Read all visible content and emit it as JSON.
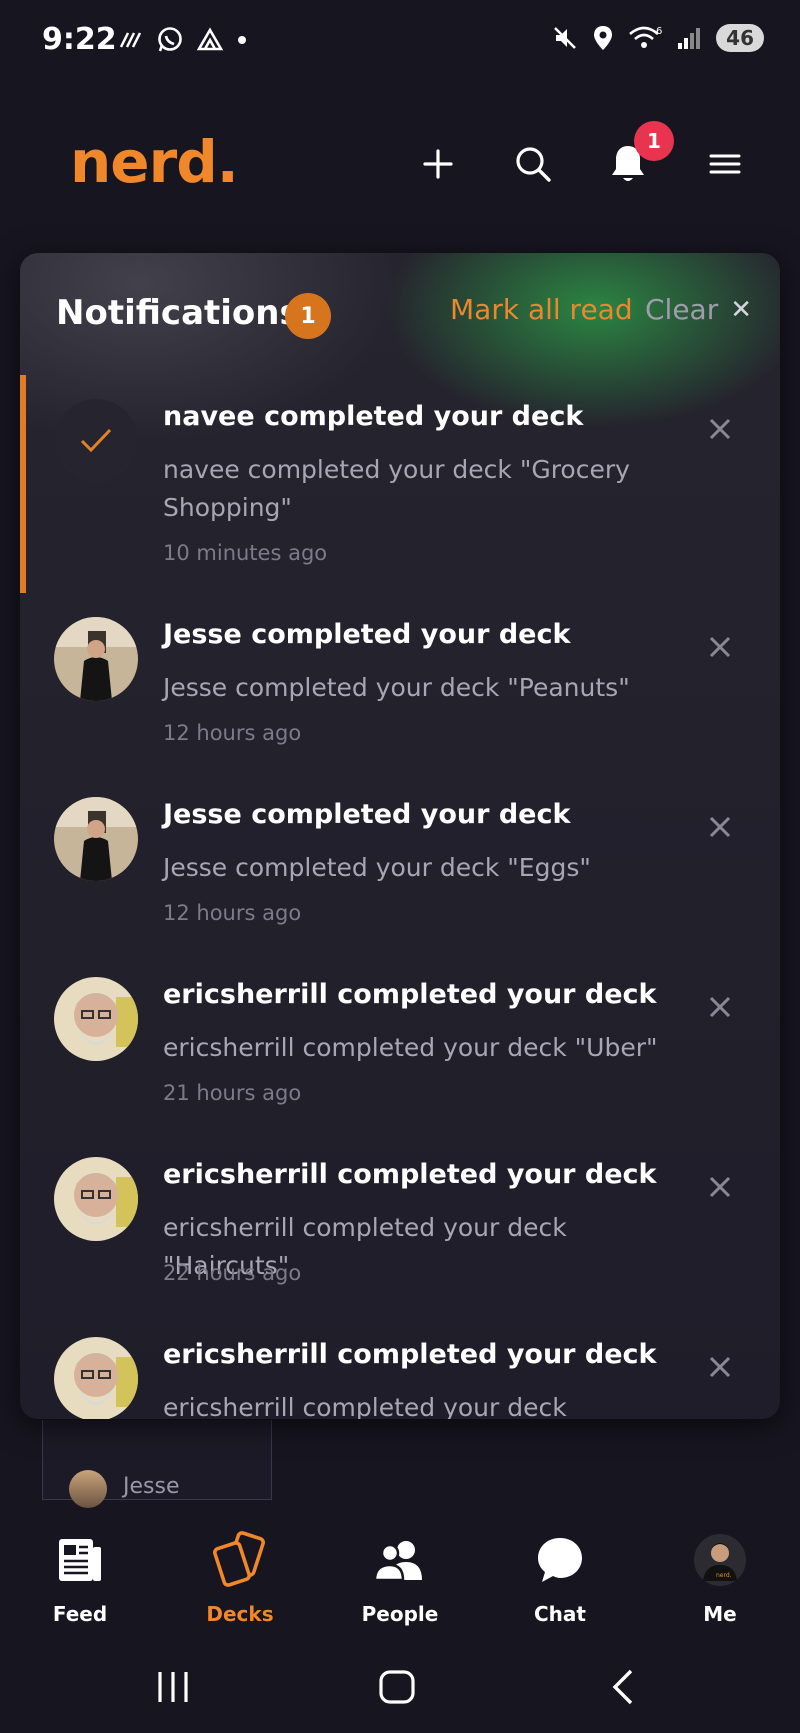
{
  "status_bar": {
    "time": "9:22",
    "battery": "46"
  },
  "header": {
    "logo": "nerd.",
    "notification_badge": "1"
  },
  "notifications": {
    "title": "Notifications",
    "count": "1",
    "mark_all_read": "Mark all read",
    "clear": "Clear",
    "items": [
      {
        "title": "navee completed your deck",
        "body": "navee completed your deck \"Grocery Shopping\"",
        "time": "10 minutes ago",
        "unread": true
      },
      {
        "title": "Jesse completed your deck",
        "body": "Jesse completed your deck \"Peanuts\"",
        "time": "12 hours ago"
      },
      {
        "title": "Jesse completed your deck",
        "body": "Jesse completed your deck \"Eggs\"",
        "time": "12 hours ago"
      },
      {
        "title": "ericsherrill completed your deck",
        "body": "ericsherrill completed your deck \"Uber\"",
        "time": "21 hours ago"
      },
      {
        "title": "ericsherrill completed your deck",
        "body": "ericsherrill completed your deck \"Haircuts\"",
        "time": "22 hours ago"
      },
      {
        "title": "ericsherrill completed your deck",
        "body": "ericsherrill completed your deck \"Christmas"
      }
    ]
  },
  "background_card": {
    "user": "Jesse"
  },
  "bottom_nav": {
    "items": [
      {
        "label": "Feed",
        "icon": "feed-icon"
      },
      {
        "label": "Decks",
        "icon": "decks-icon",
        "active": true
      },
      {
        "label": "People",
        "icon": "people-icon"
      },
      {
        "label": "Chat",
        "icon": "chat-icon"
      },
      {
        "label": "Me",
        "icon": "profile-avatar"
      }
    ]
  },
  "colors": {
    "accent": "#f0872a",
    "badge_red": "#e8344e",
    "background": "#17151f"
  }
}
